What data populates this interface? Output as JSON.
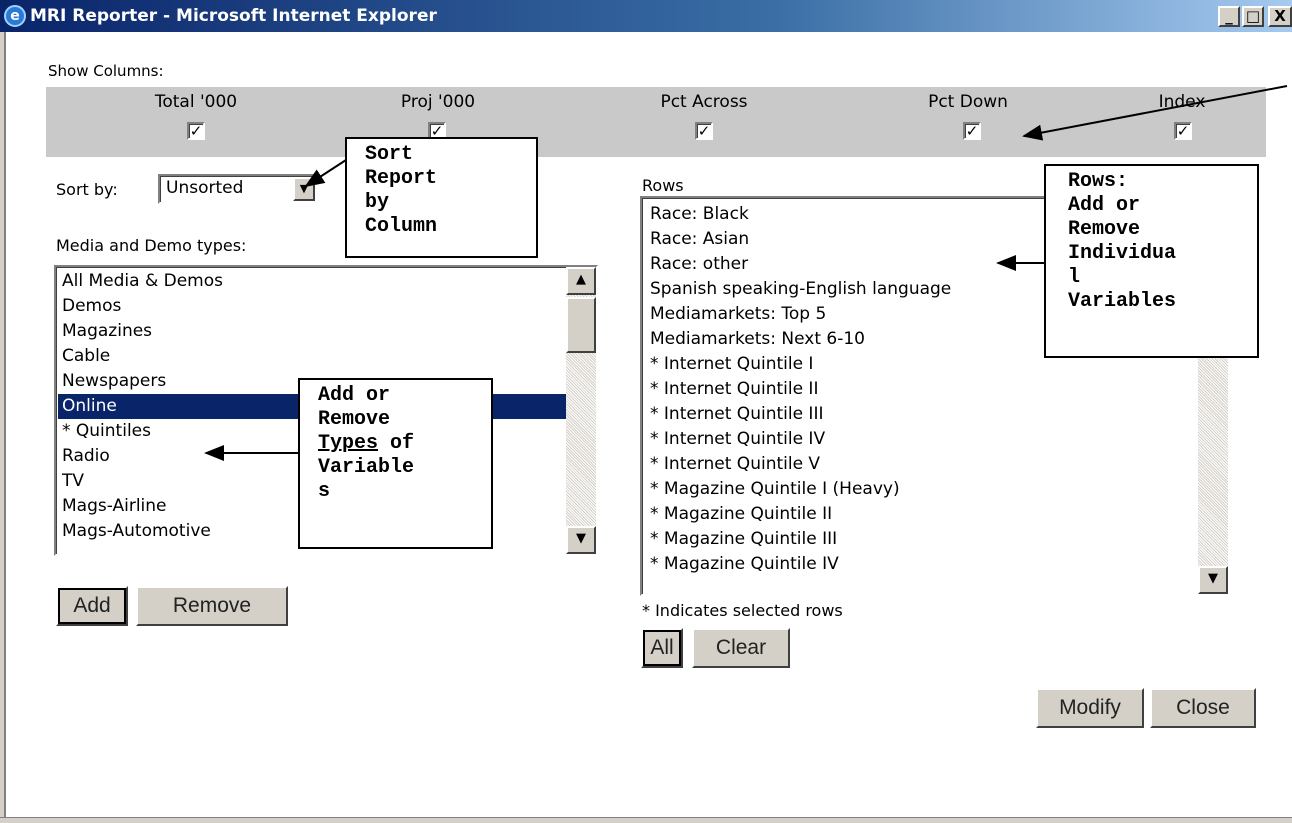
{
  "window": {
    "title": "MRI Reporter - Microsoft Internet Explorer",
    "minimize": "_",
    "maximize": "□",
    "close": "X"
  },
  "show_columns": {
    "label": "Show Columns:",
    "columns": [
      {
        "label": "Total '000",
        "checked": true
      },
      {
        "label": "Proj '000",
        "checked": true
      },
      {
        "label": "Pct Across",
        "checked": true
      },
      {
        "label": "Pct Down",
        "checked": true
      },
      {
        "label": "Index",
        "checked": true
      }
    ]
  },
  "sort": {
    "label": "Sort by:",
    "value": "Unsorted"
  },
  "media_types": {
    "label": "Media and Demo types:",
    "items": [
      "All Media & Demos",
      "Demos",
      "Magazines",
      "Cable",
      "Newspapers",
      "Online",
      "* Quintiles",
      "Radio",
      "TV",
      "Mags-Airline",
      "Mags-Automotive"
    ],
    "selected": "Online"
  },
  "rows": {
    "label": "Rows",
    "items": [
      "Race: Black",
      "Race: Asian",
      "Race: other",
      "Spanish speaking-English language",
      "Mediamarkets: Top 5",
      "Mediamarkets: Next 6-10",
      "* Internet Quintile I",
      "* Internet Quintile II",
      "* Internet Quintile III",
      "* Internet Quintile IV",
      "* Internet Quintile V",
      "* Magazine Quintile I (Heavy)",
      "* Magazine Quintile II",
      "* Magazine Quintile III",
      "* Magazine Quintile IV"
    ],
    "note": "* Indicates selected rows"
  },
  "buttons": {
    "add": "Add",
    "remove": "Remove",
    "all": "All",
    "clear": "Clear",
    "modify": "Modify",
    "close": "Close"
  },
  "callouts": {
    "sort": [
      "Sort",
      "Report",
      "by",
      "Column"
    ],
    "rows": [
      "Rows:",
      "Add or",
      "Remove",
      "Individua",
      "l",
      "Variables"
    ],
    "types": {
      "line1": "Add or",
      "line2": "Remove",
      "line3_underlined": "Types",
      "line3_rest": " of",
      "line4": "Variable",
      "line5": "s"
    }
  },
  "icons": {
    "window": "ie-icon",
    "checkbox": "check-icon",
    "dropdown": "dropdown-arrow-icon",
    "scroll_up": "scroll-up-icon",
    "scroll_down": "scroll-down-icon"
  }
}
